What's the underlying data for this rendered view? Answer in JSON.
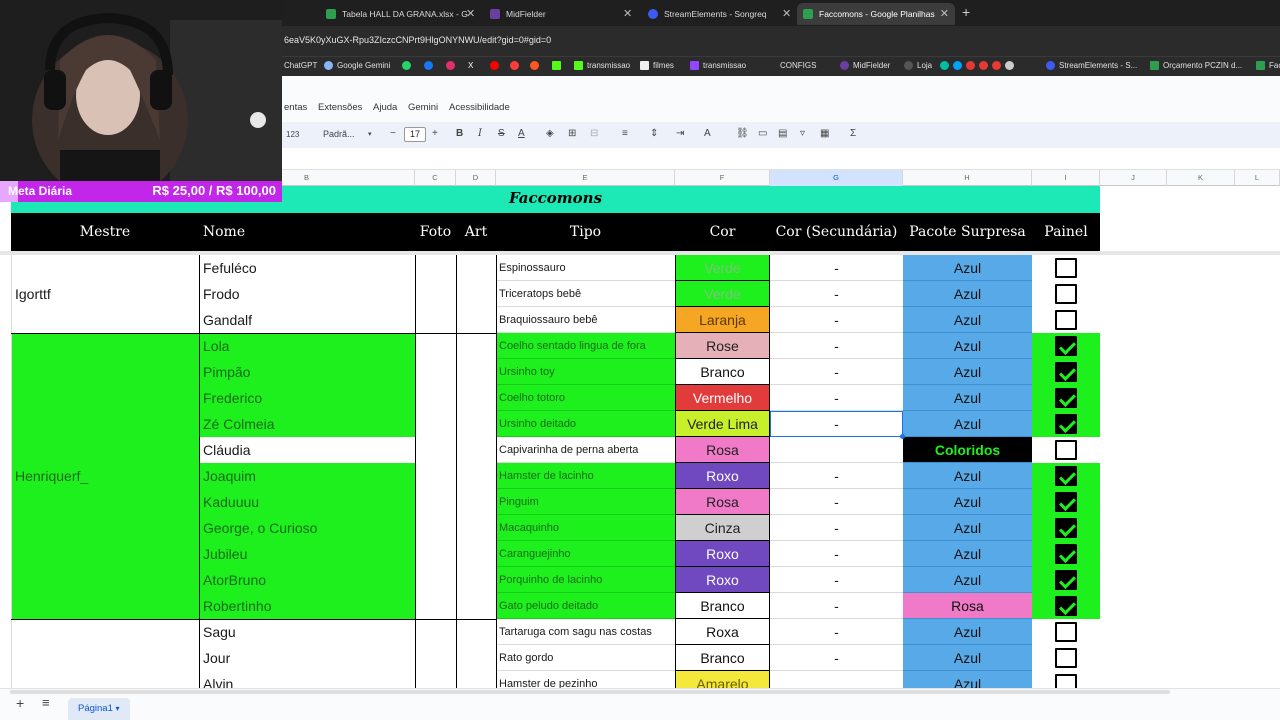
{
  "browser": {
    "tabs": [
      {
        "label": "Tabela HALL DA GRANA.xlsx - G",
        "favicon_color": "#2e9e4f"
      },
      {
        "label": "MidFielder",
        "favicon_color": "#6b3fa0"
      },
      {
        "label": "StreamElements - Songreq",
        "favicon_color": "#3d5af1"
      },
      {
        "label": "Faccomons - Google Planilhas",
        "favicon_color": "#2e9e4f",
        "active": true
      }
    ],
    "url": "6eaV5K0yXuGX-Rpu3ZIczcCNPrt9HlgONYNWU/edit?gid=0#gid=0",
    "bookmarks": [
      "ChatGPT",
      "Google Gemini",
      "transmissao",
      "filmes",
      "transmissao",
      "CONFIGS",
      "MidFielder",
      "Loja",
      "StreamElements - S...",
      "Orçamento PCZIN d...",
      "Facc"
    ]
  },
  "sheets_menu": [
    "entas",
    "Extensões",
    "Ajuda",
    "Gemini",
    "Acessibilidade"
  ],
  "toolbar": {
    "format_label": "123",
    "font_name": "Padrã...",
    "font_size": "17",
    "minus": "−",
    "plus": "+"
  },
  "columns": [
    "B",
    "C",
    "D",
    "E",
    "F",
    "G",
    "H",
    "I",
    "J",
    "K",
    "L"
  ],
  "sheet": {
    "title": "Faccomons",
    "headers": {
      "mestre": "Mestre",
      "nome": "Nome",
      "foto": "Foto",
      "art": "Art",
      "tipo": "Tipo",
      "cor": "Cor",
      "cor_sec": "Cor (Secundária)",
      "pacote": "Pacote Surpresa",
      "painel": "Painel"
    },
    "mestres": [
      "Igorttf",
      "Henriquerf_"
    ],
    "rows": [
      {
        "nome": "Fefuléco",
        "tipo": "Espinossauro",
        "cor": "Verde",
        "sec": "-",
        "pacote": "Azul"
      },
      {
        "nome": "Frodo",
        "tipo": "Triceratops bebê",
        "cor": "Verde",
        "sec": "-",
        "pacote": "Azul"
      },
      {
        "nome": "Gandalf",
        "tipo": "Braquiossauro bebê",
        "cor": "Laranja",
        "sec": "-",
        "pacote": "Azul"
      },
      {
        "nome": "Lola",
        "tipo": "Coelho sentado lingua de fora",
        "cor": "Rose",
        "sec": "-",
        "pacote": "Azul"
      },
      {
        "nome": "Pimpão",
        "tipo": "Ursinho toy",
        "cor": "Branco",
        "sec": "-",
        "pacote": "Azul"
      },
      {
        "nome": "Frederico",
        "tipo": "Coelho totoro",
        "cor": "Vermelho",
        "sec": "-",
        "pacote": "Azul"
      },
      {
        "nome": "Zé Colmeia",
        "tipo": "Ursinho deitado",
        "cor": "Verde Lima",
        "sec": "-",
        "pacote": "Azul"
      },
      {
        "nome": "Cláudia",
        "tipo": "Capivarinha de perna aberta",
        "cor": "Rosa",
        "sec": "",
        "pacote": "Coloridos"
      },
      {
        "nome": "Joaquim",
        "tipo": "Hamster de lacinho",
        "cor": "Roxo",
        "sec": "-",
        "pacote": "Azul"
      },
      {
        "nome": "Kaduuuu",
        "tipo": "Pinguim",
        "cor": "Rosa",
        "sec": "-",
        "pacote": "Azul"
      },
      {
        "nome": "George, o Curioso",
        "tipo": "Macaquinho",
        "cor": "Cinza",
        "sec": "-",
        "pacote": "Azul"
      },
      {
        "nome": "Jubileu",
        "tipo": "Caranguejinho",
        "cor": "Roxo",
        "sec": "-",
        "pacote": "Azul"
      },
      {
        "nome": "AtorBruno",
        "tipo": "Porquinho de lacinho",
        "cor": "Roxo",
        "sec": "-",
        "pacote": "Azul"
      },
      {
        "nome": "Robertinho",
        "tipo": "Gato peludo deitado",
        "cor": "Branco",
        "sec": "-",
        "pacote": "Rosa"
      },
      {
        "nome": "Sagu",
        "tipo": "Tartaruga com sagu nas costas",
        "cor": "Roxa",
        "sec": "-",
        "pacote": "Azul"
      },
      {
        "nome": "Jour",
        "tipo": "Rato gordo",
        "cor": "Branco",
        "sec": "-",
        "pacote": "Azul"
      },
      {
        "nome": "Alvin",
        "tipo": "Hamster de pezinho",
        "cor": "Amarelo",
        "sec": "",
        "pacote": "Azul"
      }
    ],
    "painel": [
      false,
      false,
      false,
      true,
      true,
      true,
      true,
      false,
      true,
      true,
      true,
      true,
      true,
      true,
      false,
      false,
      false
    ],
    "colors": {
      "accent_teal": "#1de9b6",
      "highlight_green": "#1df01d",
      "blue_cell": "#58a9e8",
      "pink_cell": "#f07ac8"
    }
  },
  "bottom": {
    "add": "+",
    "menu": "≡",
    "sheet_tab": "Página1",
    "caret": "▾"
  },
  "overlay": {
    "goal_label": "Meta Diária",
    "goal_amount": "R$ 25,00 / R$ 100,00",
    "goal_progress": 0.25
  }
}
